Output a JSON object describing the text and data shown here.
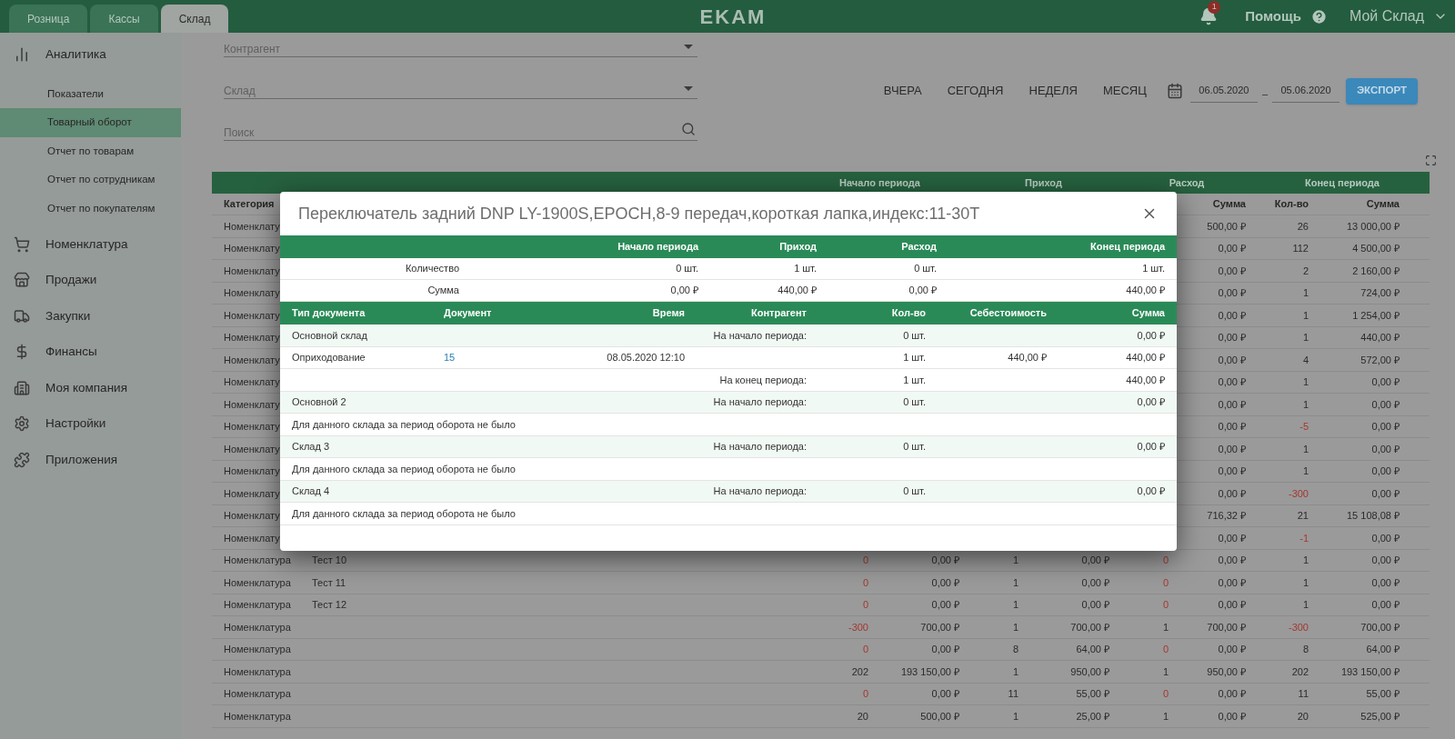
{
  "top_bar": {
    "tabs": [
      {
        "label": "Розница",
        "selected": false
      },
      {
        "label": "Кассы",
        "selected": false
      },
      {
        "label": "Склад",
        "selected": true
      }
    ],
    "logo": "EKAM",
    "notification_count": "1",
    "help": "Помощь",
    "account": "Мой Склад"
  },
  "sidebar": {
    "sections": [
      {
        "label": "Аналитика",
        "children": [
          {
            "label": "Показатели",
            "selected": false
          },
          {
            "label": "Товарный оборот",
            "selected": true
          },
          {
            "label": "Отчет по товарам",
            "selected": false
          },
          {
            "label": "Отчет по сотрудникам",
            "selected": false
          },
          {
            "label": "Отчет по покупателям",
            "selected": false
          }
        ]
      },
      {
        "label": "Номенклатура"
      },
      {
        "label": "Продажи"
      },
      {
        "label": "Закупки"
      },
      {
        "label": "Финансы"
      },
      {
        "label": "Моя компания"
      },
      {
        "label": "Настройки"
      },
      {
        "label": "Приложения"
      }
    ]
  },
  "filters": {
    "fields": [
      {
        "kind": "select",
        "placeholder": "Контрагент"
      },
      {
        "kind": "select",
        "placeholder": "Склад"
      },
      {
        "kind": "search",
        "placeholder": "Поиск"
      }
    ],
    "periods": [
      "ВЧЕРА",
      "СЕГОДНЯ",
      "НЕДЕЛЯ",
      "МЕСЯЦ"
    ],
    "date_from": "06.05.2020",
    "date_separator": "–",
    "date_to": "05.06.2020",
    "export_button": "ЭКСПОРТ"
  },
  "report_table": {
    "groups": [
      "Начало периода",
      "Приход",
      "Расход",
      "Конец периода"
    ],
    "columns": {
      "category": "Категория",
      "out_sum": "Сумма",
      "end_qty": "Кол-во",
      "end_sum": "Сумма"
    },
    "rows": [
      {
        "category": "Номенклату",
        "out_sum": "500,00 ₽",
        "end_qty": {
          "text": "26",
          "alert": false
        },
        "end_sum": "13 000,00 ₽"
      },
      {
        "category": "Номенклату",
        "out_sum": "0,00 ₽",
        "end_qty": {
          "text": "112",
          "alert": false
        },
        "end_sum": "4 500,00 ₽"
      },
      {
        "category": "Номенклату",
        "out_sum": "0,00 ₽",
        "end_qty": {
          "text": "2",
          "alert": false
        },
        "end_sum": "2 160,00 ₽"
      },
      {
        "category": "Номенклату",
        "out_sum": "0,00 ₽",
        "end_qty": {
          "text": "1",
          "alert": false
        },
        "end_sum": "724,00 ₽"
      },
      {
        "category": "Номенклату",
        "out_sum": "0,00 ₽",
        "end_qty": {
          "text": "1",
          "alert": false
        },
        "end_sum": "1 254,00 ₽"
      },
      {
        "category": "Номенклату",
        "out_sum": "0,00 ₽",
        "end_qty": {
          "text": "1",
          "alert": false
        },
        "end_sum": "440,00 ₽"
      },
      {
        "category": "Номенклату",
        "out_sum": "0,00 ₽",
        "end_qty": {
          "text": "4",
          "alert": false
        },
        "end_sum": "572,00 ₽"
      },
      {
        "category": "Номенклату",
        "out_sum": "0,00 ₽",
        "end_qty": {
          "text": "1",
          "alert": false
        },
        "end_sum": "0,00 ₽"
      },
      {
        "category": "Номенклату",
        "out_sum": "0,00 ₽",
        "end_qty": {
          "text": "1",
          "alert": false
        },
        "end_sum": "0,00 ₽"
      },
      {
        "category": "Номенклату",
        "out_sum": "0,00 ₽",
        "end_qty": {
          "text": "-5",
          "alert": true
        },
        "end_sum": "0,00 ₽"
      },
      {
        "category": "Номенклату",
        "out_sum": "0,00 ₽",
        "end_qty": {
          "text": "1",
          "alert": false
        },
        "end_sum": "0,00 ₽"
      },
      {
        "category": "Номенклату",
        "out_sum": "0,00 ₽",
        "end_qty": {
          "text": "1",
          "alert": false
        },
        "end_sum": "0,00 ₽"
      },
      {
        "category": "Номенклату",
        "out_sum": "0,00 ₽",
        "end_qty": {
          "text": "-300",
          "alert": true
        },
        "end_sum": "0,00 ₽"
      },
      {
        "category": "Номенклату",
        "out_sum": "716,32 ₽",
        "end_qty": {
          "text": "21",
          "alert": false
        },
        "end_sum": "15 108,08 ₽"
      },
      {
        "category": "Номенклату",
        "out_sum": "0,00 ₽",
        "end_qty": {
          "text": "-1",
          "alert": true
        },
        "end_sum": "0,00 ₽"
      },
      {
        "category": "Номенклатура",
        "name": "Тест 10",
        "start_qty": {
          "text": "0",
          "alert": true
        },
        "start_sum": "0,00 ₽",
        "in_qty": {
          "text": "1",
          "alert": false
        },
        "in_sum": "0,00 ₽",
        "out_qty": {
          "text": "0",
          "alert": true
        },
        "out_sum": "0,00 ₽",
        "end_qty": {
          "text": "1",
          "alert": false
        },
        "end_sum": "0,00 ₽"
      },
      {
        "category": "Номенклатура",
        "name": "Тест 11",
        "start_qty": {
          "text": "0",
          "alert": true
        },
        "start_sum": "0,00 ₽",
        "in_qty": {
          "text": "1",
          "alert": false
        },
        "in_sum": "0,00 ₽",
        "out_qty": {
          "text": "0",
          "alert": true
        },
        "out_sum": "0,00 ₽",
        "end_qty": {
          "text": "1",
          "alert": false
        },
        "end_sum": "0,00 ₽"
      },
      {
        "category": "Номенклатура",
        "name": "Тест 12",
        "start_qty": {
          "text": "0",
          "alert": true
        },
        "start_sum": "0,00 ₽",
        "in_qty": {
          "text": "1",
          "alert": false
        },
        "in_sum": "0,00 ₽",
        "out_qty": {
          "text": "0",
          "alert": true
        },
        "out_sum": "0,00 ₽",
        "end_qty": {
          "text": "1",
          "alert": false
        },
        "end_sum": "0,00 ₽"
      },
      {
        "category": "Номенклатура",
        "start_qty": {
          "text": "-300",
          "alert": true
        },
        "start_sum": "700,00 ₽",
        "in_qty": {
          "text": "1",
          "alert": false
        },
        "in_sum": "700,00 ₽",
        "out_qty": {
          "text": "1",
          "alert": false
        },
        "out_sum": "700,00 ₽",
        "end_qty": {
          "text": "-300",
          "alert": true
        },
        "end_sum": "700,00 ₽"
      },
      {
        "category": "Номенклатура",
        "start_qty": {
          "text": "0",
          "alert": true
        },
        "start_sum": "0,00 ₽",
        "in_qty": {
          "text": "8",
          "alert": false
        },
        "in_sum": "64,00 ₽",
        "out_qty": {
          "text": "0",
          "alert": true
        },
        "out_sum": "0,00 ₽",
        "end_qty": {
          "text": "8",
          "alert": false
        },
        "end_sum": "64,00 ₽"
      },
      {
        "category": "Номенклатура",
        "start_qty": {
          "text": "202",
          "alert": false
        },
        "start_sum": "193 150,00 ₽",
        "in_qty": {
          "text": "1",
          "alert": false
        },
        "in_sum": "950,00 ₽",
        "out_qty": {
          "text": "1",
          "alert": false
        },
        "out_sum": "950,00 ₽",
        "end_qty": {
          "text": "202",
          "alert": false
        },
        "end_sum": "193 150,00 ₽"
      },
      {
        "category": "Номенклатура",
        "start_qty": {
          "text": "0",
          "alert": true
        },
        "start_sum": "0,00 ₽",
        "in_qty": {
          "text": "11",
          "alert": false
        },
        "in_sum": "55,00 ₽",
        "out_qty": {
          "text": "0",
          "alert": true
        },
        "out_sum": "0,00 ₽",
        "end_qty": {
          "text": "11",
          "alert": false
        },
        "end_sum": "55,00 ₽"
      },
      {
        "category": "Номенклатура",
        "start_qty": {
          "text": "20",
          "alert": false
        },
        "start_sum": "500,00 ₽",
        "in_qty": {
          "text": "1",
          "alert": false
        },
        "in_sum": "25,00 ₽",
        "out_qty": {
          "text": "1",
          "alert": false
        },
        "out_sum": "0,00 ₽",
        "end_qty": {
          "text": "20",
          "alert": false
        },
        "end_sum": "525,00 ₽"
      }
    ]
  },
  "modal": {
    "title": "Переключатель задний DNP LY-1900S,EPOCH,8-9 передач,короткая лапка,индекс:11-30T",
    "summary": {
      "columns": [
        "Начало периода",
        "Приход",
        "Расход",
        "Конец периода"
      ],
      "rows": [
        {
          "label": "Количество",
          "values": [
            "0 шт.",
            "1 шт.",
            "0 шт.",
            "1 шт."
          ]
        },
        {
          "label": "Сумма",
          "values": [
            "0,00 ₽",
            "440,00 ₽",
            "0,00 ₽",
            "440,00 ₽"
          ]
        }
      ]
    },
    "movements": {
      "columns": [
        "Тип документа",
        "Документ",
        "Время",
        "Контрагент",
        "Кол-во",
        "Себестоимость",
        "Сумма"
      ],
      "rows": [
        {
          "kind": "warehouse",
          "type": "Основной склад",
          "counterparty": "На начало периода:",
          "qty": "0 шт.",
          "sum": "0,00 ₽"
        },
        {
          "kind": "document",
          "type": "Оприходование",
          "document": "15",
          "time": "08.05.2020 12:10",
          "qty": "1 шт.",
          "cost": "440,00 ₽",
          "sum": "440,00 ₽"
        },
        {
          "kind": "total",
          "counterparty": "На конец периода:",
          "qty": "1 шт.",
          "sum": "440,00 ₽"
        },
        {
          "kind": "warehouse",
          "type": "Основной 2",
          "counterparty": "На начало периода:",
          "qty": "0 шт.",
          "sum": "0,00 ₽"
        },
        {
          "kind": "note",
          "text": "Для данного склада за период оборота не было"
        },
        {
          "kind": "warehouse",
          "type": "Склад 3",
          "counterparty": "На начало периода:",
          "qty": "0 шт.",
          "sum": "0,00 ₽"
        },
        {
          "kind": "note",
          "text": "Для данного склада за период оборота не было"
        },
        {
          "kind": "warehouse",
          "type": "Склад 4",
          "counterparty": "На начало периода:",
          "qty": "0 шт.",
          "sum": "0,00 ₽"
        },
        {
          "kind": "note",
          "text": "Для данного склада за период оборота не было"
        }
      ]
    }
  }
}
